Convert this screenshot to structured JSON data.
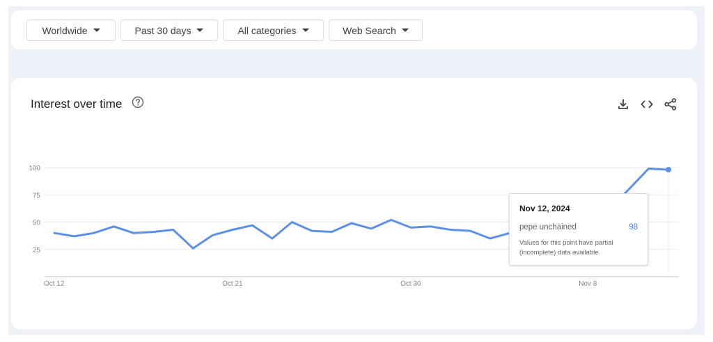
{
  "filters": [
    {
      "label": "Worldwide"
    },
    {
      "label": "Past 30 days"
    },
    {
      "label": "All categories"
    },
    {
      "label": "Web Search"
    }
  ],
  "chart_card": {
    "title": "Interest over time",
    "icons": [
      "help-icon",
      "download-icon",
      "embed-icon",
      "share-icon"
    ]
  },
  "colors": {
    "line": "#5b8fe8",
    "grid": "#e8eaed",
    "axis": "#bdc1c6",
    "tick_text": "#80868b"
  },
  "tooltip": {
    "date": "Nov 12, 2024",
    "term": "pepe unchained",
    "value": "98",
    "note": "Values for this point have partial (incomplete) data available"
  },
  "chart_data": {
    "type": "line",
    "title": "Interest over time",
    "xlabel": "",
    "ylabel": "",
    "ylim": [
      0,
      100
    ],
    "yticks": [
      25,
      50,
      75,
      100
    ],
    "xticks": [
      "Oct 12",
      "Oct 21",
      "Oct 30",
      "Nov 8"
    ],
    "grid": true,
    "x": [
      "Oct 12",
      "Oct 13",
      "Oct 14",
      "Oct 15",
      "Oct 16",
      "Oct 17",
      "Oct 18",
      "Oct 19",
      "Oct 20",
      "Oct 21",
      "Oct 22",
      "Oct 23",
      "Oct 24",
      "Oct 25",
      "Oct 26",
      "Oct 27",
      "Oct 28",
      "Oct 29",
      "Oct 30",
      "Oct 31",
      "Nov 1",
      "Nov 2",
      "Nov 3",
      "Nov 4",
      "Nov 5",
      "Nov 6",
      "Nov 7",
      "Nov 8",
      "Nov 9",
      "Nov 10",
      "Nov 11",
      "Nov 12"
    ],
    "series": [
      {
        "name": "pepe unchained",
        "values": [
          40,
          37,
          40,
          46,
          40,
          41,
          43,
          26,
          38,
          43,
          47,
          35,
          50,
          42,
          41,
          49,
          44,
          52,
          45,
          46,
          43,
          42,
          35,
          40,
          43,
          57,
          61,
          61,
          62,
          80,
          99,
          98
        ],
        "partial_last": true
      }
    ]
  }
}
